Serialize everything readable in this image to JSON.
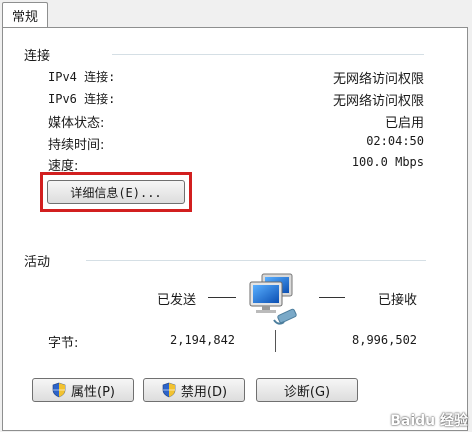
{
  "tab": {
    "label": "常规"
  },
  "connection": {
    "heading": "连接",
    "rows": [
      {
        "label": "IPv4 连接:",
        "value": "无网络访问权限"
      },
      {
        "label": "IPv6 连接:",
        "value": "无网络访问权限"
      },
      {
        "label": "媒体状态:",
        "value": "已启用"
      },
      {
        "label": "持续时间:",
        "value": "02:04:50"
      },
      {
        "label": "速度:",
        "value": "100.0 Mbps"
      }
    ],
    "details_button": "详细信息(E)..."
  },
  "activity": {
    "heading": "活动",
    "sent_label": "已发送",
    "received_label": "已接收",
    "bytes_label": "字节:",
    "bytes_sent": "2,194,842",
    "bytes_received": "8,996,502"
  },
  "buttons": {
    "properties": "属性(P)",
    "disable": "禁用(D)",
    "diagnose": "诊断(G)"
  },
  "watermark": {
    "text": "Baidu 经验"
  },
  "colors": {
    "highlight": "#d21f1f",
    "border": "#8e8f8f"
  }
}
